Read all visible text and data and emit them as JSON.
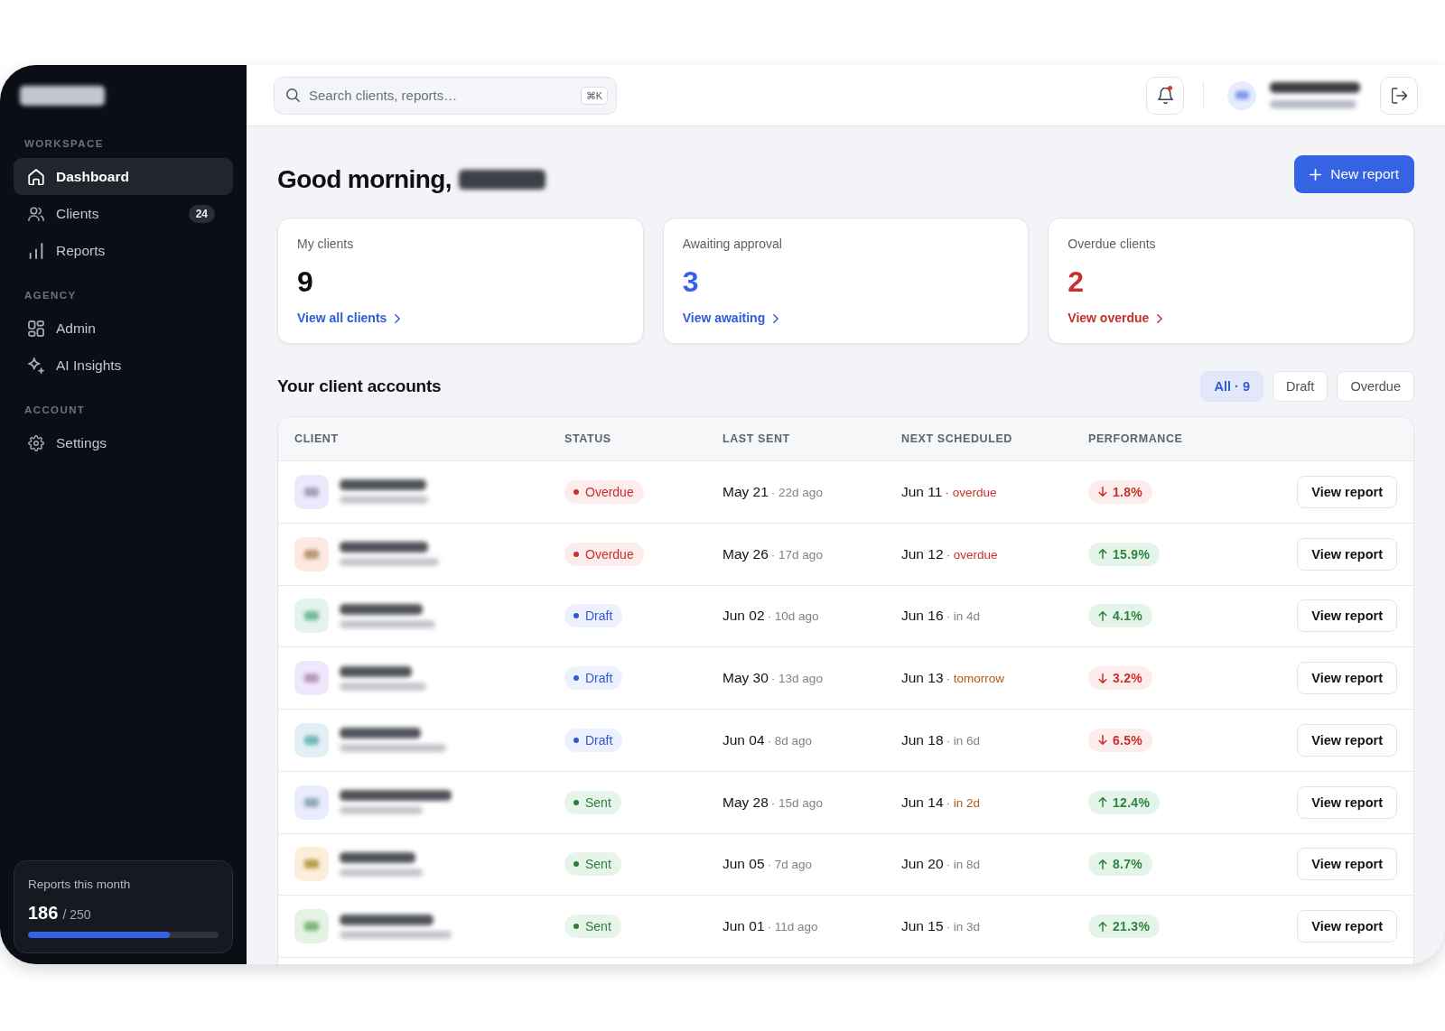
{
  "sidebar": {
    "sections": [
      {
        "heading": "WORKSPACE",
        "items": [
          {
            "label": "Dashboard",
            "selected": true
          },
          {
            "label": "Clients",
            "selected": false,
            "badge": "24"
          },
          {
            "label": "Reports",
            "selected": false
          }
        ]
      },
      {
        "heading": "AGENCY",
        "items": [
          {
            "label": "Admin",
            "selected": false
          },
          {
            "label": "AI Insights",
            "selected": false
          }
        ]
      },
      {
        "heading": "ACCOUNT",
        "items": [
          {
            "label": "Settings",
            "selected": false
          }
        ]
      }
    ],
    "usage": {
      "label": "Reports this month",
      "value": "186",
      "total": "/ 250",
      "level": 0.744
    }
  },
  "topbar": {
    "search": {
      "placeholder": "Search clients, reports…",
      "shortcut": "⌘K"
    },
    "notifications": {
      "unread": true
    }
  },
  "greeting": "Good morning,",
  "new_report_button": "New report",
  "stat_cards": [
    {
      "label": "My clients",
      "value": "9",
      "link": "View all clients",
      "kind": "neutral"
    },
    {
      "label": "Awaiting approval",
      "value": "3",
      "link": "View awaiting",
      "kind": "accent"
    },
    {
      "label": "Overdue clients",
      "value": "2",
      "link": "View overdue",
      "kind": "danger"
    }
  ],
  "accounts": {
    "title": "Your client accounts",
    "filters": [
      {
        "label": "All · 9",
        "selected": true
      },
      {
        "label": "Draft",
        "selected": false
      },
      {
        "label": "Overdue",
        "selected": false
      }
    ],
    "table": {
      "columns": [
        "CLIENT",
        "STATUS",
        "LAST SENT",
        "NEXT SCHEDULED",
        "PERFORMANCE"
      ],
      "rows": [
        {
          "color": "#ebe9fc",
          "status": {
            "label": "Overdue",
            "kind": "overdue"
          },
          "last_sent": {
            "date": "May 21",
            "note": "· 22d ago"
          },
          "next": {
            "date": "Jun 11",
            "note": "· overdue",
            "kind": "overdue"
          },
          "change": {
            "value": "1.8%",
            "kind": "down"
          },
          "action": "View report"
        },
        {
          "color": "#fde9e1",
          "status": {
            "label": "Overdue",
            "kind": "overdue"
          },
          "last_sent": {
            "date": "May 26",
            "note": "· 17d ago"
          },
          "next": {
            "date": "Jun 12",
            "note": "· overdue",
            "kind": "overdue"
          },
          "change": {
            "value": "15.9%",
            "kind": "up"
          },
          "action": "View report"
        },
        {
          "color": "#e4f3ec",
          "status": {
            "label": "Draft",
            "kind": "draft"
          },
          "last_sent": {
            "date": "Jun 02",
            "note": "· 10d ago"
          },
          "next": {
            "date": "Jun 16",
            "note": "· in 4d",
            "kind": "normal"
          },
          "change": {
            "value": "4.1%",
            "kind": "up"
          },
          "action": "View report"
        },
        {
          "color": "#efe8fd",
          "status": {
            "label": "Draft",
            "kind": "draft"
          },
          "last_sent": {
            "date": "May 30",
            "note": "· 13d ago"
          },
          "next": {
            "date": "Jun 13",
            "note": "· tomorrow",
            "kind": "soon"
          },
          "change": {
            "value": "3.2%",
            "kind": "down"
          },
          "action": "View report"
        },
        {
          "color": "#e2f0f5",
          "status": {
            "label": "Draft",
            "kind": "draft"
          },
          "last_sent": {
            "date": "Jun 04",
            "note": "· 8d ago"
          },
          "next": {
            "date": "Jun 18",
            "note": "· in 6d",
            "kind": "normal"
          },
          "change": {
            "value": "6.5%",
            "kind": "down"
          },
          "action": "View report"
        },
        {
          "color": "#e8ecfc",
          "status": {
            "label": "Sent",
            "kind": "sent"
          },
          "last_sent": {
            "date": "May 28",
            "note": "· 15d ago"
          },
          "next": {
            "date": "Jun 14",
            "note": "· in 2d",
            "kind": "soon"
          },
          "change": {
            "value": "12.4%",
            "kind": "up"
          },
          "action": "View report"
        },
        {
          "color": "#fdeddc",
          "status": {
            "label": "Sent",
            "kind": "sent"
          },
          "last_sent": {
            "date": "Jun 05",
            "note": "· 7d ago"
          },
          "next": {
            "date": "Jun 20",
            "note": "· in 8d",
            "kind": "normal"
          },
          "change": {
            "value": "8.7%",
            "kind": "up"
          },
          "action": "View report"
        },
        {
          "color": "#e5f3e5",
          "status": {
            "label": "Sent",
            "kind": "sent"
          },
          "last_sent": {
            "date": "Jun 01",
            "note": "· 11d ago"
          },
          "next": {
            "date": "Jun 15",
            "note": "· in 3d",
            "kind": "normal"
          },
          "change": {
            "value": "21.3%",
            "kind": "up"
          },
          "action": "View report"
        }
      ]
    }
  }
}
